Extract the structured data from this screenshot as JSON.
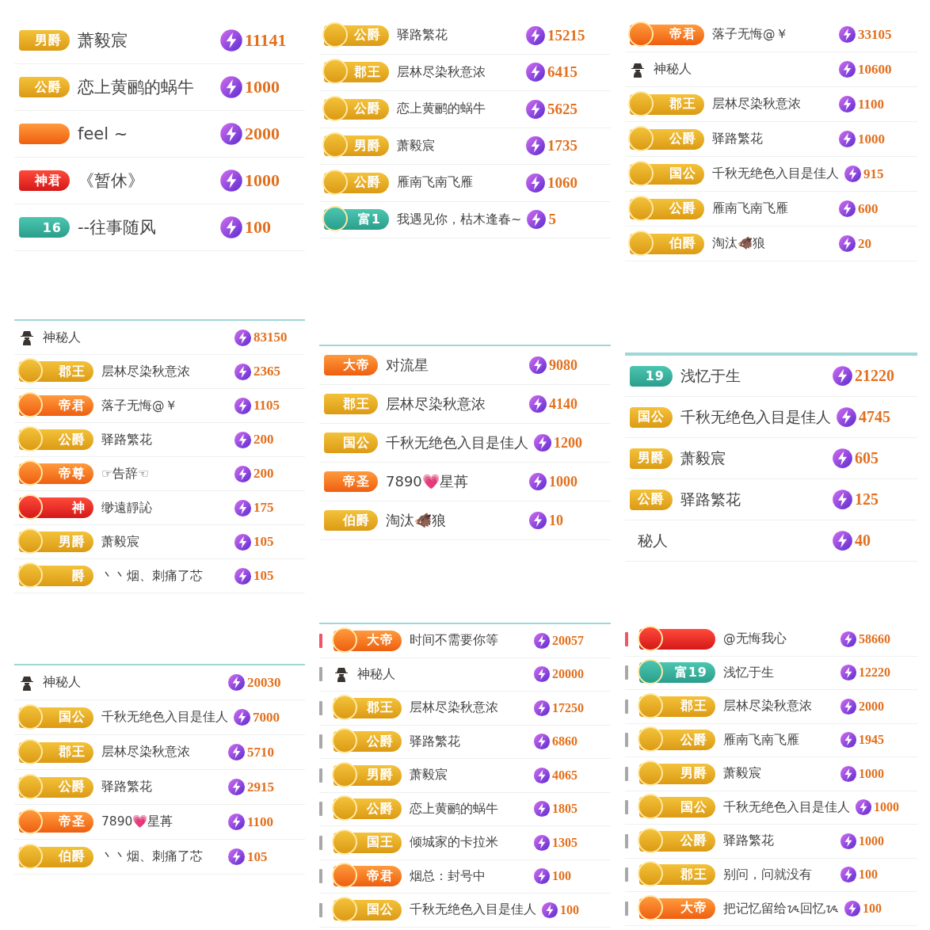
{
  "panels": [
    {
      "rows": [
        {
          "badge": {
            "kind": "gold",
            "label": "男爵"
          },
          "name": "萧毅宸",
          "value": "11141"
        },
        {
          "badge": {
            "kind": "gold",
            "label": "公爵"
          },
          "name": "恋上黄鹂的蜗牛",
          "value": "1000"
        },
        {
          "badge": {
            "kind": "orange"
          },
          "name": "feel ~",
          "value": "2000"
        },
        {
          "badge": {
            "kind": "red",
            "label": "神君"
          },
          "name": "《暂休》",
          "value": "1000"
        },
        {
          "badge": {
            "kind": "teal",
            "label": "16"
          },
          "name": "--往事随风",
          "value": "100"
        }
      ]
    },
    {
      "rows": [
        {
          "badge": {
            "kind": "gold",
            "label": "公爵",
            "emblem": true
          },
          "name": "驿路繁花",
          "value": "15215"
        },
        {
          "badge": {
            "kind": "gold",
            "label": "郡王",
            "emblem": true
          },
          "name": "层林尽染秋意浓",
          "value": "6415"
        },
        {
          "badge": {
            "kind": "gold",
            "label": "公爵",
            "emblem": true
          },
          "name": "恋上黄鹂的蜗牛",
          "value": "5625"
        },
        {
          "badge": {
            "kind": "gold",
            "label": "男爵",
            "emblem": true
          },
          "name": "萧毅宸",
          "value": "1735"
        },
        {
          "badge": {
            "kind": "gold",
            "label": "公爵",
            "emblem": true
          },
          "name": "雁南飞南飞雁",
          "value": "1060"
        },
        {
          "badge": {
            "kind": "teal",
            "label": "富1",
            "emblem": true
          },
          "name": "我遇见你，枯木逢春~",
          "value": "5"
        }
      ]
    },
    {
      "rows": [
        {
          "badge": {
            "kind": "orange",
            "label": "帝君",
            "emblem": true
          },
          "name": "落子无悔@￥",
          "value": "33105"
        },
        {
          "badge": {
            "kind": "mystery"
          },
          "name": "神秘人",
          "value": "10600"
        },
        {
          "badge": {
            "kind": "gold",
            "label": "郡王",
            "emblem": true
          },
          "name": "层林尽染秋意浓",
          "value": "1100"
        },
        {
          "badge": {
            "kind": "gold",
            "label": "公爵",
            "emblem": true
          },
          "name": "驿路繁花",
          "value": "1000"
        },
        {
          "badge": {
            "kind": "gold",
            "label": "国公",
            "emblem": true
          },
          "name": "千秋无绝色入目是佳人",
          "value": "915"
        },
        {
          "badge": {
            "kind": "gold",
            "label": "公爵",
            "emblem": true
          },
          "name": "雁南飞南飞雁",
          "value": "600"
        },
        {
          "badge": {
            "kind": "gold",
            "label": "伯爵",
            "emblem": true
          },
          "name": "淘汰🐗狼",
          "value": "20"
        }
      ]
    },
    {
      "rule": true,
      "rows": [
        {
          "badge": {
            "kind": "mystery"
          },
          "name": "神秘人",
          "value": "83150"
        },
        {
          "badge": {
            "kind": "gold",
            "label": "郡王",
            "emblem": true
          },
          "name": "层林尽染秋意浓",
          "value": "2365"
        },
        {
          "badge": {
            "kind": "orange",
            "label": "帝君",
            "emblem": true
          },
          "name": "落子无悔@￥",
          "value": "1105"
        },
        {
          "badge": {
            "kind": "gold",
            "label": "公爵",
            "emblem": true
          },
          "name": "驿路繁花",
          "value": "200"
        },
        {
          "badge": {
            "kind": "orange",
            "label": "帝尊",
            "emblem": true
          },
          "name": "☞告辞☜",
          "value": "200"
        },
        {
          "badge": {
            "kind": "red",
            "label": "神",
            "emblem": true
          },
          "name": "缈遠靜訫",
          "value": "175"
        },
        {
          "badge": {
            "kind": "gold",
            "label": "男爵",
            "emblem": true
          },
          "name": "萧毅宸",
          "value": "105"
        },
        {
          "badge": {
            "kind": "gold",
            "label": "爵",
            "emblem": true
          },
          "name": "丶丶烟、刺痛了芯",
          "value": "105"
        }
      ]
    },
    {
      "rule": true,
      "rows": [
        {
          "badge": {
            "kind": "orange",
            "label": "大帝"
          },
          "name": "对流星",
          "value": "9080"
        },
        {
          "badge": {
            "kind": "gold",
            "label": "郡王"
          },
          "name": "层林尽染秋意浓",
          "value": "4140"
        },
        {
          "badge": {
            "kind": "gold",
            "label": "国公"
          },
          "name": "千秋无绝色入目是佳人",
          "value": "1200"
        },
        {
          "badge": {
            "kind": "orange",
            "label": "帝圣"
          },
          "name": "7890💗星苒",
          "value": "1000"
        },
        {
          "badge": {
            "kind": "gold",
            "label": "伯爵"
          },
          "name": "淘汰🐗狼",
          "value": "10"
        }
      ]
    },
    {
      "rule": true,
      "rows": [
        {
          "badge": {
            "kind": "teal",
            "label": "19"
          },
          "name": "浅忆于生",
          "value": "21220"
        },
        {
          "badge": {
            "kind": "gold",
            "label": "国公"
          },
          "name": "千秋无绝色入目是佳人",
          "value": "4745"
        },
        {
          "badge": {
            "kind": "gold",
            "label": "男爵"
          },
          "name": "萧毅宸",
          "value": "605"
        },
        {
          "badge": {
            "kind": "gold",
            "label": "公爵"
          },
          "name": "驿路繁花",
          "value": "125"
        },
        {
          "name": "秘人",
          "value": "40"
        }
      ]
    },
    {
      "rule": true,
      "rows": [
        {
          "badge": {
            "kind": "mystery"
          },
          "name": "神秘人",
          "value": "20030"
        },
        {
          "badge": {
            "kind": "gold",
            "label": "国公",
            "emblem": true
          },
          "name": "千秋无绝色入目是佳人",
          "value": "7000"
        },
        {
          "badge": {
            "kind": "gold",
            "label": "郡王",
            "emblem": true
          },
          "name": "层林尽染秋意浓",
          "value": "5710"
        },
        {
          "badge": {
            "kind": "gold",
            "label": "公爵",
            "emblem": true
          },
          "name": "驿路繁花",
          "value": "2915"
        },
        {
          "badge": {
            "kind": "orange",
            "label": "帝圣",
            "emblem": true
          },
          "name": "7890💗星苒",
          "value": "1100"
        },
        {
          "badge": {
            "kind": "gold",
            "label": "伯爵",
            "emblem": true
          },
          "name": "丶丶烟、刺痛了芯",
          "value": "105"
        }
      ]
    },
    {
      "rule": true,
      "rows": [
        {
          "highlight": true,
          "badge": {
            "kind": "orange",
            "label": "大帝",
            "emblem": true
          },
          "name": "时间不需要你等",
          "value": "20057"
        },
        {
          "highlight": false,
          "badge": {
            "kind": "mystery"
          },
          "name": "神秘人",
          "value": "20000"
        },
        {
          "highlight": false,
          "badge": {
            "kind": "gold",
            "label": "郡王",
            "emblem": true
          },
          "name": "层林尽染秋意浓",
          "value": "17250"
        },
        {
          "highlight": false,
          "badge": {
            "kind": "gold",
            "label": "公爵",
            "emblem": true
          },
          "name": "驿路繁花",
          "value": "6860"
        },
        {
          "highlight": false,
          "badge": {
            "kind": "gold",
            "label": "男爵",
            "emblem": true
          },
          "name": "萧毅宸",
          "value": "4065"
        },
        {
          "highlight": false,
          "badge": {
            "kind": "gold",
            "label": "公爵",
            "emblem": true
          },
          "name": "恋上黄鹂的蜗牛",
          "value": "1805"
        },
        {
          "highlight": false,
          "badge": {
            "kind": "gold",
            "label": "国王",
            "emblem": true
          },
          "name": "倾城家的卡拉米",
          "value": "1305"
        },
        {
          "highlight": false,
          "badge": {
            "kind": "orange",
            "label": "帝君",
            "emblem": true
          },
          "name": "烟总：封号中",
          "value": "100"
        },
        {
          "highlight": false,
          "badge": {
            "kind": "gold",
            "label": "国公",
            "emblem": true
          },
          "name": "千秋无绝色入目是佳人",
          "value": "100"
        }
      ]
    },
    {
      "rows": [
        {
          "highlight": true,
          "badge": {
            "kind": "red",
            "emblem": true
          },
          "name": "@无悔我心",
          "value": "58660"
        },
        {
          "highlight": false,
          "badge": {
            "kind": "teal",
            "label": "富19",
            "emblem": true
          },
          "name": "浅忆于生",
          "value": "12220"
        },
        {
          "highlight": false,
          "badge": {
            "kind": "gold",
            "label": "郡王",
            "emblem": true
          },
          "name": "层林尽染秋意浓",
          "value": "2000"
        },
        {
          "highlight": false,
          "badge": {
            "kind": "gold",
            "label": "公爵",
            "emblem": true
          },
          "name": "雁南飞南飞雁",
          "value": "1945"
        },
        {
          "highlight": false,
          "badge": {
            "kind": "gold",
            "label": "男爵",
            "emblem": true
          },
          "name": "萧毅宸",
          "value": "1000"
        },
        {
          "highlight": false,
          "badge": {
            "kind": "gold",
            "label": "国公",
            "emblem": true
          },
          "name": "千秋无绝色入目是佳人",
          "value": "1000"
        },
        {
          "highlight": false,
          "badge": {
            "kind": "gold",
            "label": "公爵",
            "emblem": true
          },
          "name": "驿路繁花",
          "value": "1000"
        },
        {
          "highlight": false,
          "badge": {
            "kind": "gold",
            "label": "郡王",
            "emblem": true
          },
          "name": "别问，问就没有",
          "value": "100"
        },
        {
          "highlight": false,
          "badge": {
            "kind": "orange",
            "label": "大帝",
            "emblem": true
          },
          "name": "把记忆留给ᝰ回忆ᝰ",
          "value": "100"
        }
      ]
    }
  ]
}
